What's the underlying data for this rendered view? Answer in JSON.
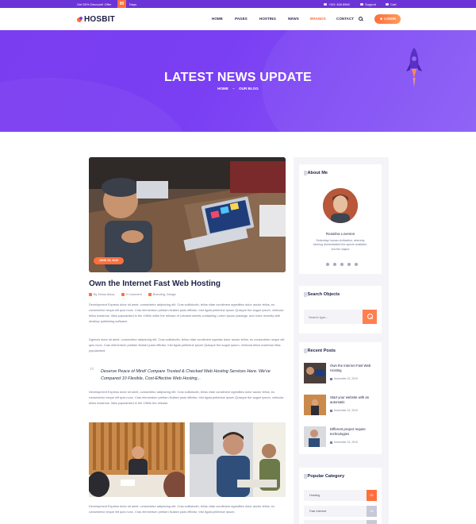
{
  "topbar": {
    "promo": "Get 50% Discount! Offer",
    "count": "00",
    "days": "Days",
    "phone": "+301 458 8960",
    "support": "Support",
    "cart": "Cart"
  },
  "header": {
    "logo": "HOSBIT",
    "nav": [
      "HOME",
      "PAGES",
      "HOSTING",
      "NEWS",
      "BRANDS",
      "CONTACT"
    ],
    "active_nav": "BRANDS",
    "login": "LOGIN"
  },
  "hero": {
    "title": "LATEST NEWS UPDATE",
    "crumb_home": "HOME",
    "crumb_sep": "–",
    "crumb_current": "OUR BLOG"
  },
  "post": {
    "date": "JUNE 25, 2020",
    "title": "Own the Internet Fast Web Hosting",
    "author": "By Zimus Akixa,",
    "comments": "0 Comment",
    "tags": "Branding, Design",
    "p1": "Development Express dolor sit amet, consectetur adipiscing elit. Cras sollicitudin, tellus vitae condimem egestliteo dolor auctor tellus, eu consectetur neque elit quis nunc. Cras elementum pretlam Nullam justo efficitur, trist ligula pellentue ipsum Quisque flor augue ipsum, vehicula tellus maximus. Was popularised in the 1960s withe the release of Letraset sheets containing Lorem Ipsum passage, and more recently with desktop publishing software.",
    "p2": "Dgenvis dolor sit amet, consectetur adipiscing elit. Cras sollicitudin, tellus vitae condimem egestas dolor auctor tellus, eu consectetur neque elit quis nunc. Cras elementum pretlam Nullam justo efficitur, trist ligula pellentue ipsum Quisque flor augue ipsum, vehicula tellus maximus Was popularised.",
    "quote": "Deserve Peace of Mind! Compare Trusted & Checked Web Hosting Services Here. We've Compared 10 Flexible, Cost-Effective Web Hosting...",
    "p3": "Development Express dolor sit amet, consectetur adipiscing elit. Cras sollicitudin, tellus vitae condimem egestliteo dolor auctor tellus, eu consectetur neque elit quis nunc. Cras elementum pretlam Nullam justo efficitur, trist ligula pellentue ipsum Quisque flor augue ipsum, vehicula tellus maximus. Was popularised in the 1960s the release.",
    "p4": "Development Express dolor sit amet, consectetur adipiscing elit. Cras sollicitudin, tellus vitae condimem egestliteo dolor auctor tellus, eu consectetur neque elit quis nunc. Cras elementum pretlam Nullam justo efficitur, trist ligula pellentue ipsum."
  },
  "sidebar": {
    "about_title": "About Me",
    "about_name": "Rosalina Loveson",
    "about_text": "Sedenbay human civilization, whereby farming domesticated the specie available, but the majors",
    "search_title": "Search Objects",
    "search_placeholder": "Search type...",
    "recent_title": "Recent Posts",
    "recent": [
      {
        "title": "Own the Internet Fast Web Hosting",
        "date": "November 22, 2019"
      },
      {
        "title": "Start your website with an automatic",
        "date": "November 22, 2019"
      },
      {
        "title": "Different project require technologies",
        "date": "November 22, 2019"
      }
    ],
    "category_title": "Popular Category",
    "categories": [
      {
        "name": "Hosting",
        "count": "03"
      },
      {
        "name": "Fast Internet",
        "count": "08"
      },
      {
        "name": "",
        "count": ""
      }
    ]
  },
  "colors": {
    "accent": "#ff6f3c",
    "purple": "#7b3df0",
    "dark": "#1d2144"
  }
}
